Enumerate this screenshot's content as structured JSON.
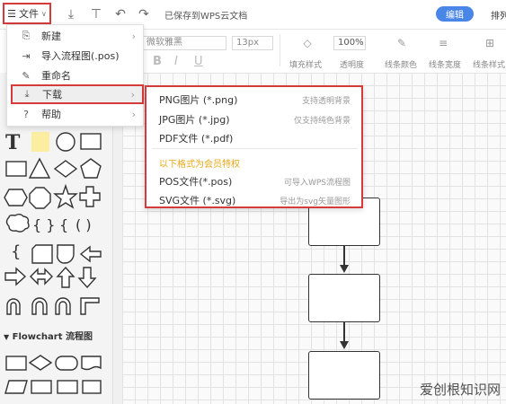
{
  "toolbar": {
    "file_label": "文件",
    "saved_status": "已保存到WPS云文档",
    "edit_label": "编辑",
    "arrange_label": "排列"
  },
  "format_bar": {
    "font_name": "微软雅黑",
    "font_size": "13px",
    "zoom": "100%",
    "labels": [
      "填充样式",
      "透明度",
      "线条颜色",
      "线条宽度",
      "线条样式"
    ]
  },
  "file_menu": {
    "items": [
      {
        "label": "新建",
        "icon": "new-file-icon",
        "has_submenu": true
      },
      {
        "label": "导入流程图(.pos)",
        "icon": "import-icon",
        "has_submenu": false
      },
      {
        "label": "重命名",
        "icon": "rename-icon",
        "has_submenu": false
      },
      {
        "label": "下载",
        "icon": "download-icon",
        "has_submenu": true,
        "highlighted": true
      },
      {
        "label": "帮助",
        "icon": "help-icon",
        "has_submenu": true
      }
    ]
  },
  "download_menu": {
    "items": [
      {
        "label": "PNG图片 (*.png)",
        "desc": "支持透明背景"
      },
      {
        "label": "JPG图片 (*.jpg)",
        "desc": "仅支持纯色背景"
      },
      {
        "label": "PDF文件 (*.pdf)",
        "desc": ""
      }
    ],
    "vip_note": "以下格式为会员特权",
    "vip_items": [
      {
        "label": "POS文件(*.pos)",
        "desc": "可导入WPS流程图"
      },
      {
        "label": "SVG文件 (*.svg)",
        "desc": "导出为svg矢量图形"
      }
    ]
  },
  "shapes_panel": {
    "section_title": "Flowchart 流程图"
  },
  "watermark": "爱创根知识网",
  "colors": {
    "highlight_border": "#d63b3b",
    "accent": "#4a86e8",
    "vip_text": "#e6a817"
  }
}
